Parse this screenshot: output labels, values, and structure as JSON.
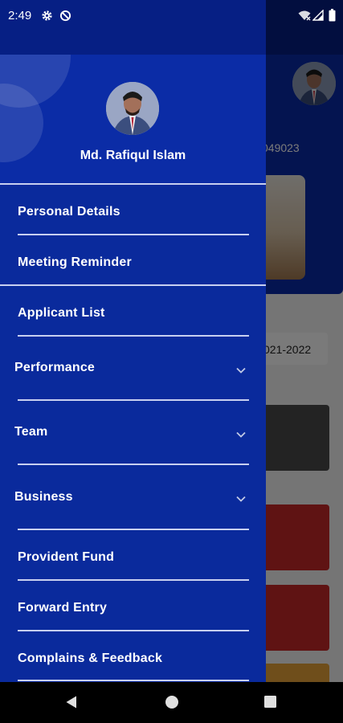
{
  "status_bar": {
    "time": "2:49",
    "icons": [
      "settings-gear-icon",
      "data-saver-icon",
      "wifi-icon",
      "signal-icon",
      "battery-icon"
    ]
  },
  "background": {
    "id_fragment": "049023",
    "year_fragment": "021-2022",
    "colors": {
      "header": "#0a2aa8",
      "tile_dark": "#4a4a4a",
      "tile_red": "#c62828",
      "tile_orange": "#e8a33a"
    }
  },
  "drawer": {
    "profile": {
      "name": "Md. Rafiqul Islam"
    },
    "items": [
      {
        "label": "Personal Details"
      },
      {
        "label": "Meeting Reminder"
      },
      {
        "label": "Applicant List"
      },
      {
        "label": "Performance",
        "expandable": true
      },
      {
        "label": "Team",
        "expandable": true
      },
      {
        "label": "Business",
        "expandable": true
      },
      {
        "label": "Provident Fund"
      },
      {
        "label": "Forward Entry"
      },
      {
        "label": "Complains & Feedback"
      }
    ],
    "colors": {
      "background": "#0a2a9c",
      "text": "#ffffff",
      "divider": "#c8d0f0"
    }
  },
  "nav_bar": {
    "buttons": [
      "back-icon",
      "home-icon",
      "recents-icon"
    ]
  }
}
